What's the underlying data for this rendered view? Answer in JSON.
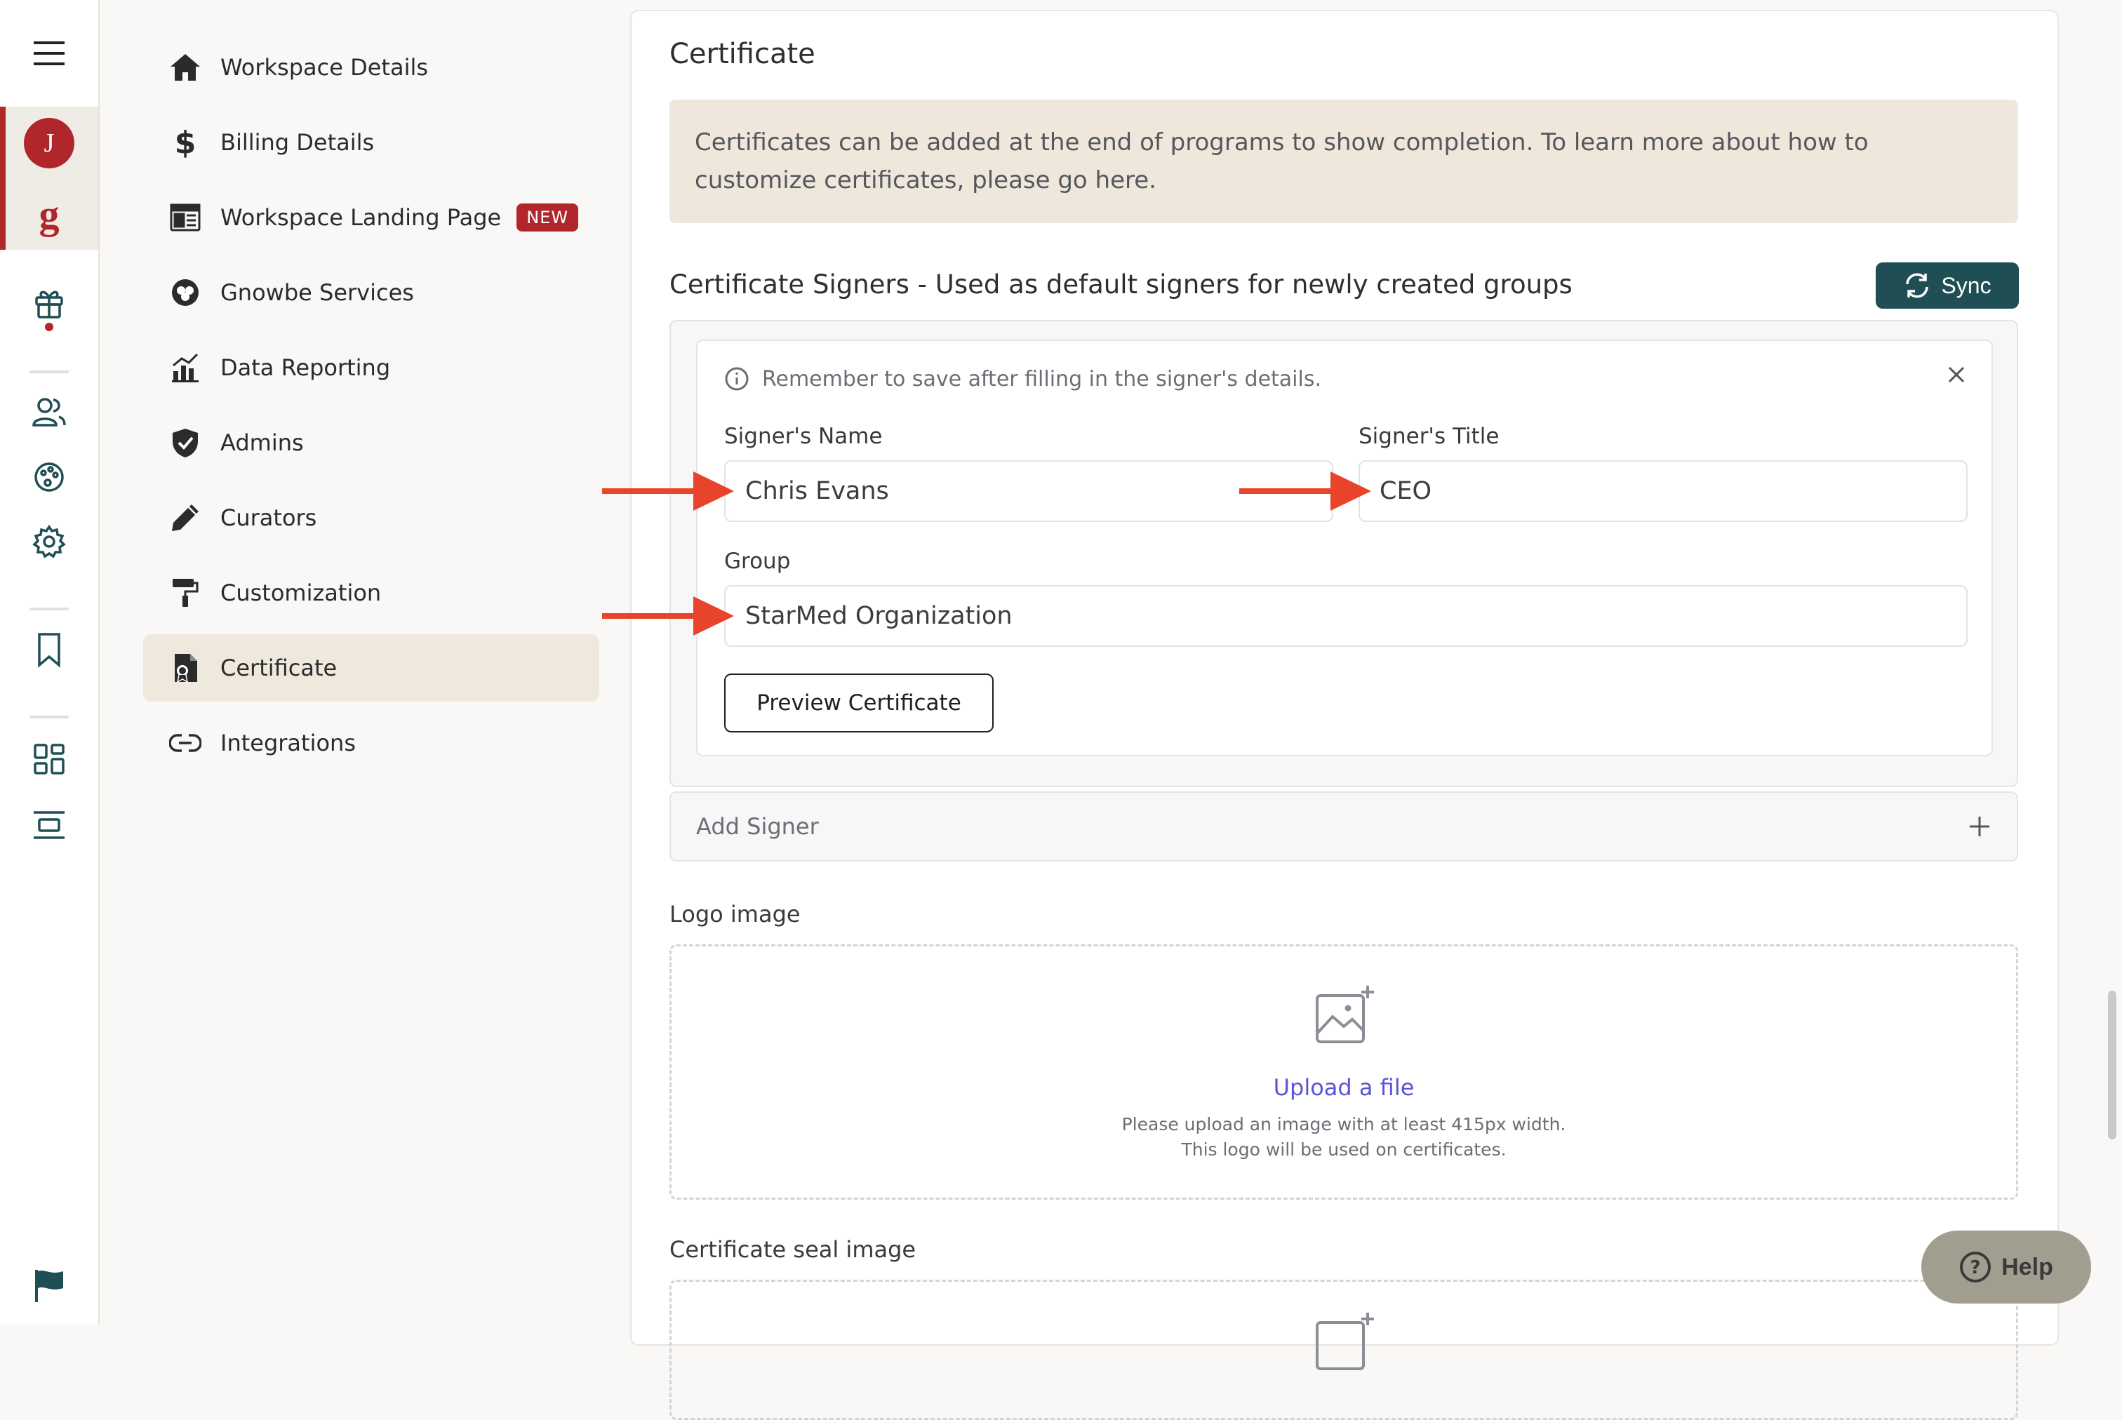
{
  "rail": {
    "avatar_initial": "J",
    "brand_letter": "g"
  },
  "nav": {
    "items": [
      {
        "label": "Workspace Details",
        "icon": "home-icon"
      },
      {
        "label": "Billing Details",
        "icon": "dollar-icon"
      },
      {
        "label": "Workspace Landing Page",
        "icon": "landing-page-icon",
        "badge": "NEW"
      },
      {
        "label": "Gnowbe Services",
        "icon": "services-icon"
      },
      {
        "label": "Data Reporting",
        "icon": "chart-icon"
      },
      {
        "label": "Admins",
        "icon": "shield-icon"
      },
      {
        "label": "Curators",
        "icon": "pencil-icon"
      },
      {
        "label": "Customization",
        "icon": "paint-roller-icon"
      },
      {
        "label": "Certificate",
        "icon": "certificate-icon",
        "active": true
      },
      {
        "label": "Integrations",
        "icon": "link-icon"
      }
    ]
  },
  "main": {
    "title": "Certificate",
    "notice": "Certificates can be added at the end of programs to show completion. To learn more about how to customize certificates, please go here.",
    "signers_title": "Certificate Signers - Used as default signers for newly created groups",
    "sync_label": "Sync",
    "reminder": "Remember to save after filling in the signer's details.",
    "signer_name_label": "Signer's Name",
    "signer_name_value": "Chris Evans",
    "signer_title_label": "Signer's Title",
    "signer_title_value": "CEO",
    "group_label": "Group",
    "group_value": "StarMed Organization",
    "preview_label": "Preview Certificate",
    "add_signer_label": "Add Signer",
    "logo_label": "Logo image",
    "upload_link": "Upload a file",
    "upload_help_1": "Please upload an image with at least 415px width.",
    "upload_help_2": "This logo will be used on certificates.",
    "seal_label": "Certificate seal image"
  },
  "help_label": "Help",
  "colors": {
    "brand_red": "#b0262a",
    "sync_teal": "#1f4f55",
    "annotation_red": "#e8432b",
    "link_purple": "#5b55d6"
  }
}
